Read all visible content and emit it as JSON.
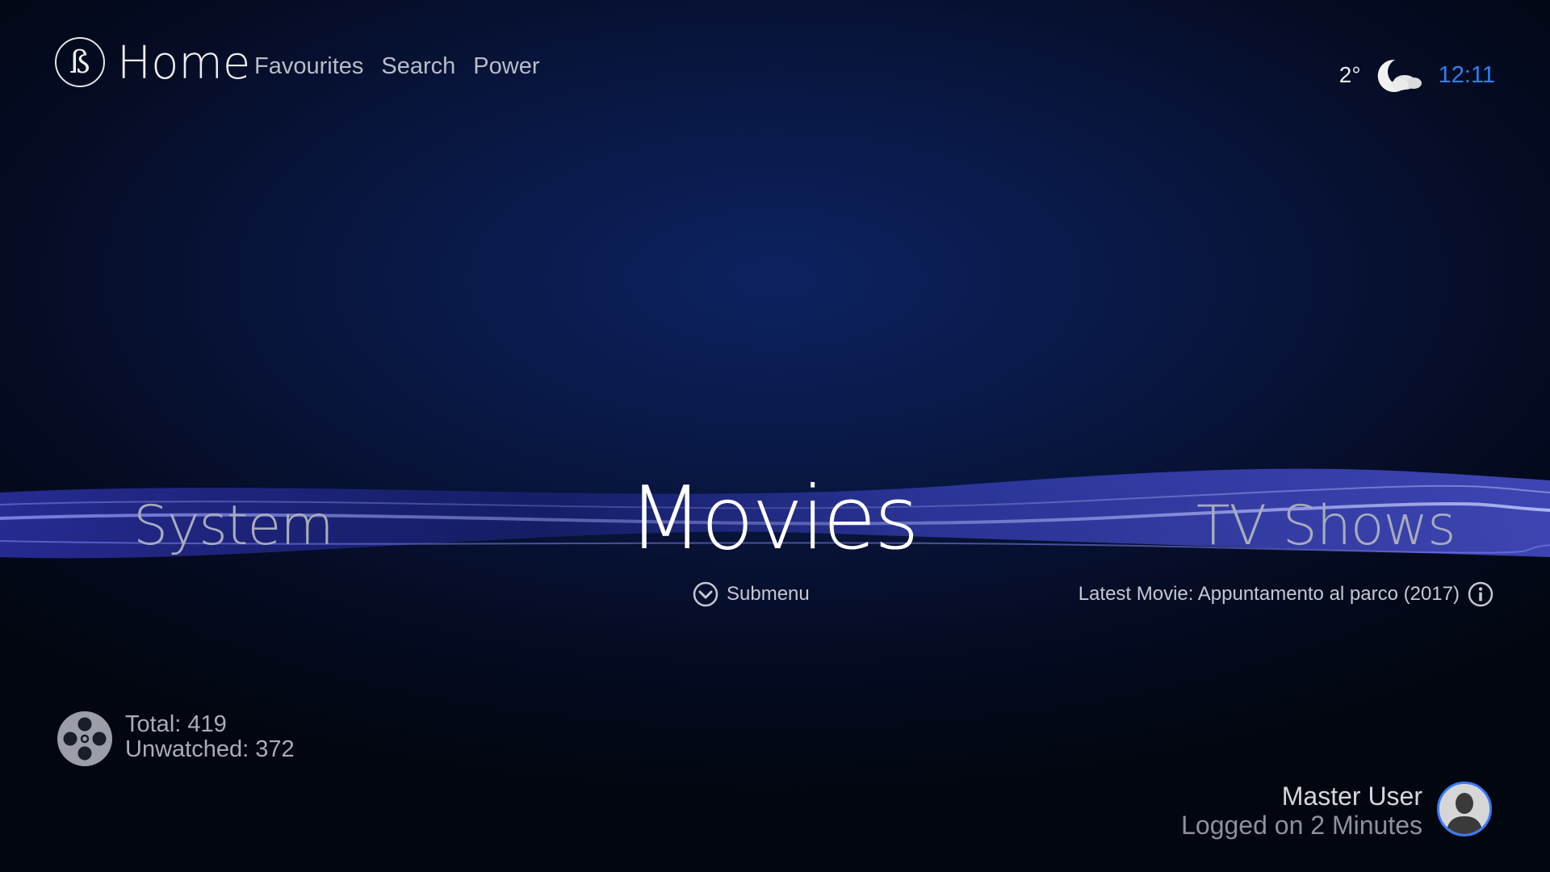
{
  "header": {
    "logo_glyph": "ß",
    "title": "Home",
    "nav": [
      {
        "label": "Favourites"
      },
      {
        "label": "Search"
      },
      {
        "label": "Power"
      }
    ]
  },
  "weather": {
    "temperature": "2°",
    "icon": "moon-cloud-icon",
    "time": "12:11"
  },
  "menu": {
    "left": "System",
    "center": "Movies",
    "right": "TV Shows"
  },
  "submenu": {
    "label": "Submenu",
    "icon": "chevron-down-circle-icon"
  },
  "latest": {
    "text": "Latest Movie: Appuntamento al parco (2017)",
    "icon": "info-icon"
  },
  "stats": {
    "icon": "film-reel-icon",
    "total": "Total: 419",
    "unwatched": "Unwatched: 372"
  },
  "user": {
    "name": "Master User",
    "status": "Logged on 2 Minutes",
    "icon": "user-avatar-icon"
  },
  "colors": {
    "accent": "#2f7ff5",
    "avatar_ring": "#3a7bff",
    "background": "#081640"
  }
}
